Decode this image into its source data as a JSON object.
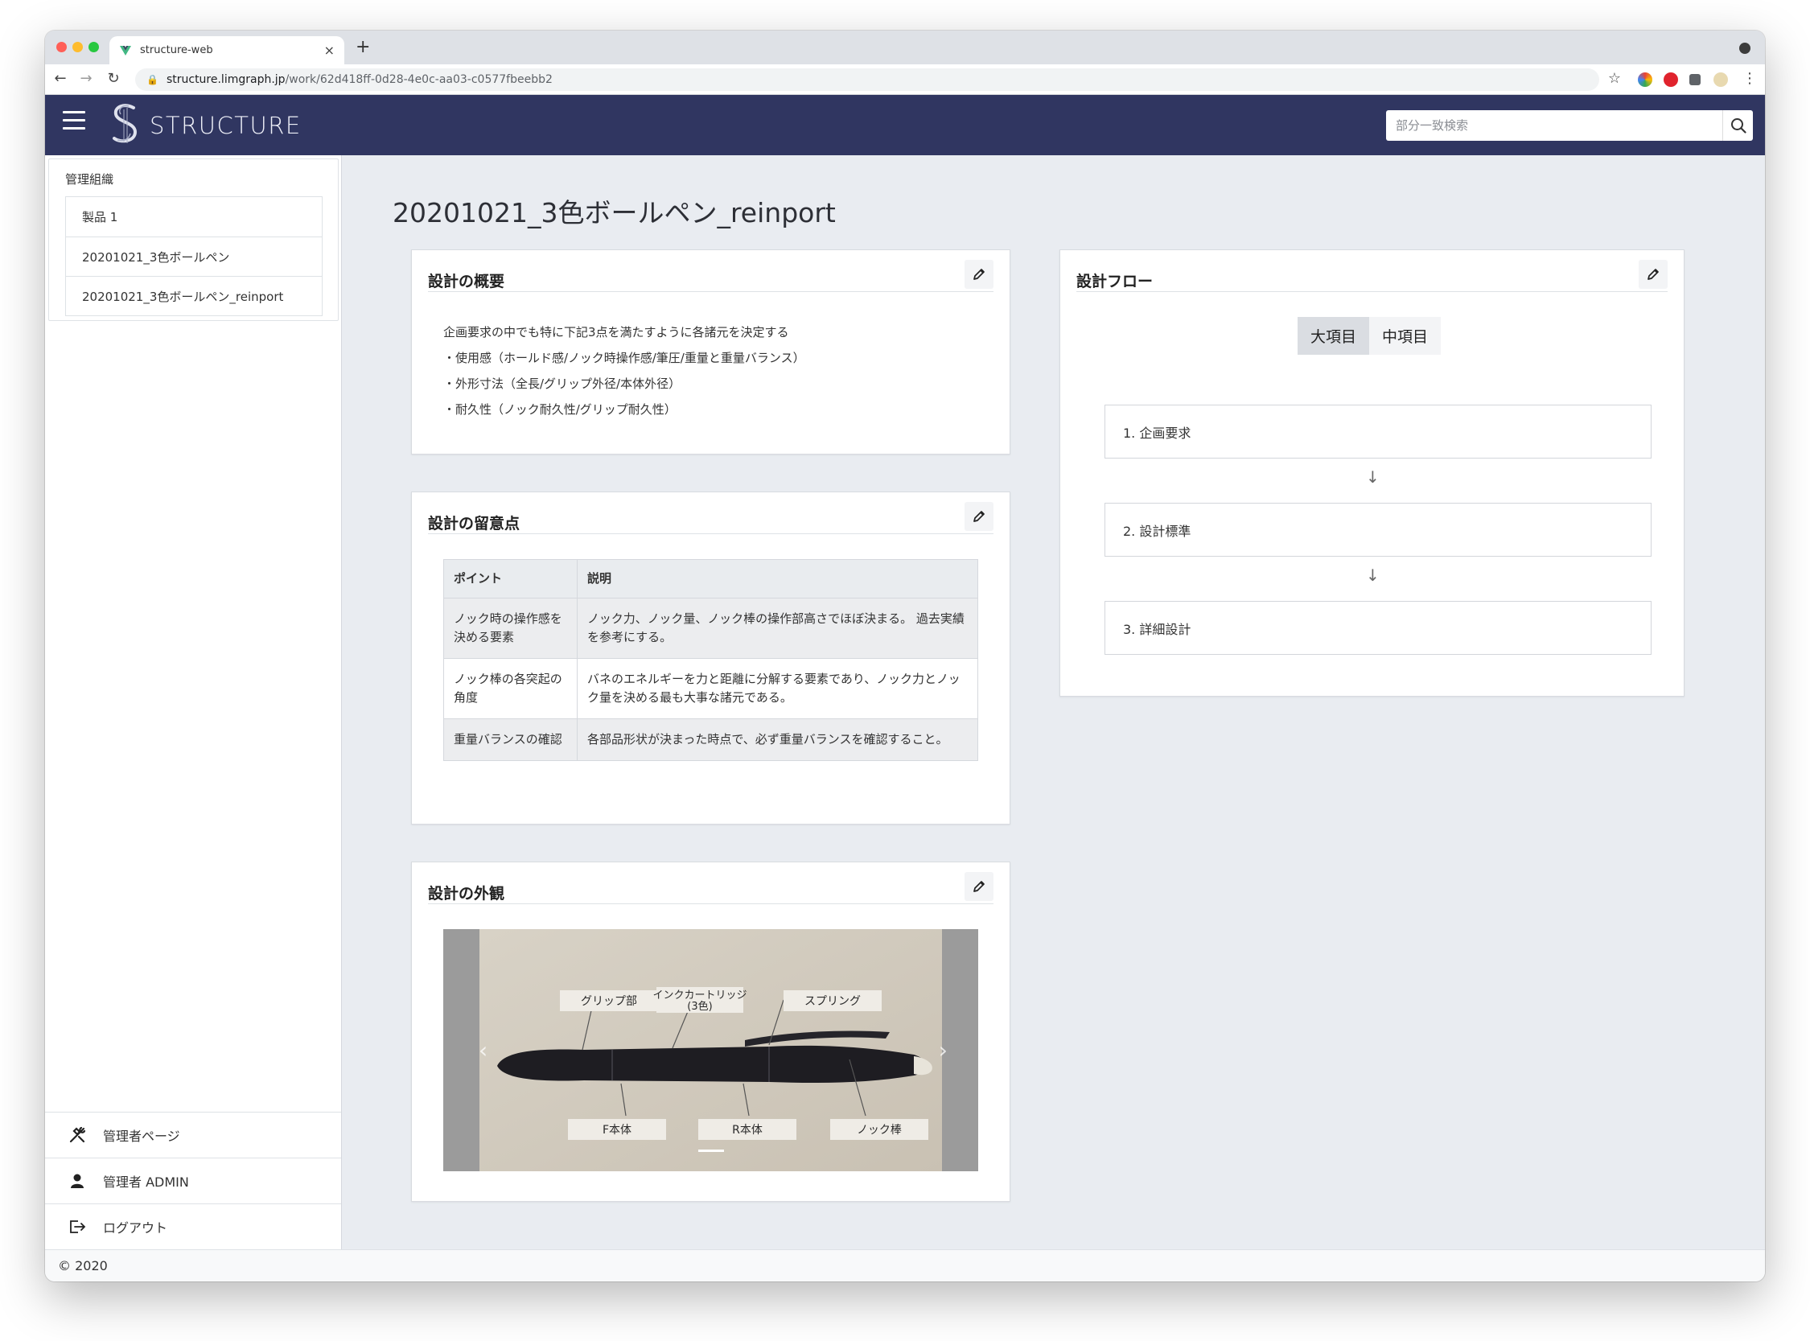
{
  "browser": {
    "tab_title": "structure-web",
    "tab_close": "×",
    "new_tab": "+",
    "url_host": "structure.limgraph.jp",
    "url_path": "/work/62d418ff-0d28-4e0c-aa03-c0577fbeebb2",
    "lock": "🔒",
    "back": "←",
    "forward": "→",
    "reload": "↻",
    "star": "☆",
    "more": "⋮"
  },
  "header": {
    "brand": "STRUCTURE",
    "search_placeholder": "部分一致検索",
    "color": "#303661"
  },
  "sidebar": {
    "org_title": "管理組織",
    "org_items": [
      {
        "label": "製品 1"
      },
      {
        "label": "20201021_3色ボールペン"
      },
      {
        "label": "20201021_3色ボールペン_reinport"
      }
    ],
    "links": [
      {
        "label": "管理者ページ",
        "icon": "tools-icon"
      },
      {
        "label": "管理者 ADMIN",
        "icon": "user-icon"
      },
      {
        "label": "ログアウト",
        "icon": "logout-icon"
      }
    ]
  },
  "footer": {
    "text": "© 2020"
  },
  "main": {
    "page_title": "20201021_3色ボールペン_reinport",
    "overview": {
      "title": "設計の概要",
      "lines": [
        "企画要求の中でも特に下記3点を満たすように各諸元を決定する",
        "・使用感（ホールド感/ノック時操作感/筆圧/重量と重量バランス）",
        "・外形寸法（全長/グリップ外径/本体外径）",
        "・耐久性（ノック耐久性/グリップ耐久性）"
      ]
    },
    "notes": {
      "title": "設計の留意点",
      "headers": [
        "ポイント",
        "説明"
      ],
      "rows": [
        {
          "point": "ノック時の操作感を決める要素",
          "desc": "ノック力、ノック量、ノック棒の操作部高さでほぼ決まる。 過去実績を参考にする。"
        },
        {
          "point": "ノック棒の各突起の角度",
          "desc": "バネのエネルギーを力と距離に分解する要素であり、ノック力とノック量を決める最も大事な諸元である。"
        },
        {
          "point": "重量バランスの確認",
          "desc": "各部品形状が決まった時点で、必ず重量バランスを確認すること。"
        }
      ]
    },
    "appearance": {
      "title": "設計の外観",
      "labels": {
        "grip": "グリップ部",
        "ink": "インクカートリッジ",
        "ink_sub": "(3色)",
        "spring": "スプリング",
        "f_body": "F本体",
        "r_body": "R本体",
        "knock": "ノック棒"
      },
      "prev": "‹",
      "next": "›"
    },
    "flow": {
      "title": "設計フロー",
      "tabs": [
        "大項目",
        "中項目"
      ],
      "active_tab": "大項目",
      "items": [
        "1. 企画要求",
        "2. 設計標準",
        "3. 詳細設計"
      ],
      "arrow": "↓"
    }
  }
}
